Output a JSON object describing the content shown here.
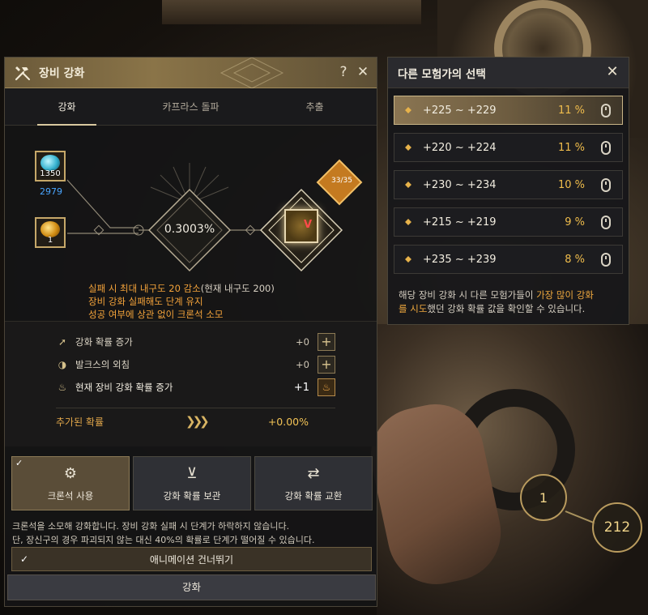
{
  "window": {
    "title": "장비 강화",
    "help_label": "?",
    "close_label": "✕"
  },
  "tabs": [
    {
      "label": "강화",
      "active": true
    },
    {
      "label": "카프라스 돌파",
      "active": false
    },
    {
      "label": "추출",
      "active": false
    }
  ],
  "materials": {
    "crystal": {
      "icon": "blue-crystal-icon",
      "qty": "1350",
      "sub": "2979"
    },
    "stone": {
      "icon": "gold-stone-icon",
      "qty": "1"
    }
  },
  "graph": {
    "rate": "0.3003%",
    "item_icon": "equipment-item-icon",
    "item_level": "V",
    "badge": "33/35"
  },
  "warnings": {
    "line1_orange": "실패 시 최대 내구도 20 감소",
    "line1_grey": "(현재 내구도 200)",
    "line2": "장비 강화 실패해도 단계 유지",
    "line3": "성공 여부에 상관 없이 크론석 소모"
  },
  "stats": [
    {
      "icon": "arrow-up-icon",
      "label": "강화 확률 증가",
      "value": "+0",
      "button": "+"
    },
    {
      "icon": "valks-icon",
      "label": "발크스의 외침",
      "value": "+0",
      "button": "+"
    },
    {
      "icon": "flame-icon",
      "label": "현재 장비 강화 확률 증가",
      "value": "+1",
      "button": "flame"
    }
  ],
  "added": {
    "label": "추가된 확률",
    "arrows": "❯❯❯",
    "value": "+0.00%"
  },
  "options": [
    {
      "icon": "cron-stone-icon",
      "label": "크론석 사용",
      "selected": true,
      "check": "✓"
    },
    {
      "icon": "download-icon",
      "label": "강화 확률 보관",
      "selected": false
    },
    {
      "icon": "swap-icon",
      "label": "강화 확률 교환",
      "selected": false
    }
  ],
  "description": {
    "line1": "크론석을 소모해 강화합니다. 장비 강화 실패 시 단계가 하락하지 않습니다.",
    "line2": "단, 장신구의 경우 파괴되지 않는 대신 40%의 확률로 단계가 떨어질 수 있습니다."
  },
  "skip_animation": {
    "check": "✓",
    "label": "애니메이션 건너뛰기",
    "checked": true
  },
  "enhance_button": "강화",
  "side_panel": {
    "title": "다른 모험가의 선택",
    "close_label": "✕",
    "choices": [
      {
        "range": "+225 ~ +229",
        "percent": "11 %"
      },
      {
        "range": "+220 ~ +224",
        "percent": "11 %"
      },
      {
        "range": "+230 ~ +234",
        "percent": "10 %"
      },
      {
        "range": "+215 ~ +219",
        "percent": "9 %"
      },
      {
        "range": "+235 ~ +239",
        "percent": "8 %"
      }
    ],
    "desc_line1_a": "해당 장비 강화 시 다른 모험가들이 ",
    "desc_line1_hl": "가장 많이 강화",
    "desc_line2_hl": "를 시도",
    "desc_line2_b": "했던 강화 확률 값을 확인할 수 있습니다."
  },
  "counters": [
    "1",
    "212"
  ],
  "colors": {
    "accent_gold": "#c6a869",
    "warning_orange": "#f4a33a",
    "percent_gold": "#f0bd4c",
    "link_blue": "#4aa6ff"
  }
}
